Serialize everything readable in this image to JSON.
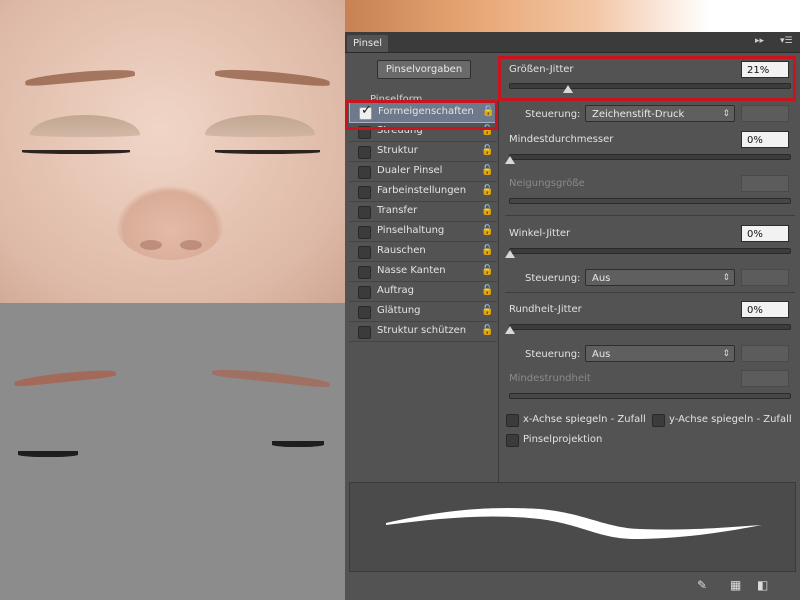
{
  "panel": {
    "tab_label": "Pinsel",
    "collapse_icon": "double-chevron-right-icon",
    "menu_icon": "panel-menu-icon",
    "preset_button": "Pinselvorgaben",
    "section_label": "Pinselform"
  },
  "options": [
    {
      "label": "Formeigenschaften",
      "checked": true,
      "selected": true
    },
    {
      "label": "Streuung",
      "checked": false
    },
    {
      "label": "Struktur",
      "checked": false
    },
    {
      "label": "Dualer Pinsel",
      "checked": false
    },
    {
      "label": "Farbeinstellungen",
      "checked": false
    },
    {
      "label": "Transfer",
      "checked": false
    },
    {
      "label": "Pinselhaltung",
      "checked": false
    },
    {
      "label": "Rauschen",
      "checked": false
    },
    {
      "label": "Nasse Kanten",
      "checked": false
    },
    {
      "label": "Auftrag",
      "checked": false
    },
    {
      "label": "Glättung",
      "checked": false
    },
    {
      "label": "Struktur schützen",
      "checked": false
    }
  ],
  "controls": {
    "size_jitter": {
      "label": "Größen-Jitter",
      "value": "21%",
      "slider": 0.21
    },
    "size_control": {
      "label": "Steuerung:",
      "value": "Zeichenstift-Druck"
    },
    "min_diameter": {
      "label": "Mindestdurchmesser",
      "value": "0%",
      "slider": 0
    },
    "tilt_scale": {
      "label": "Neigungsgröße"
    },
    "angle_jitter": {
      "label": "Winkel-Jitter",
      "value": "0%",
      "slider": 0
    },
    "angle_control": {
      "label": "Steuerung:",
      "value": "Aus"
    },
    "roundness_jitter": {
      "label": "Rundheit-Jitter",
      "value": "0%",
      "slider": 0
    },
    "roundness_control": {
      "label": "Steuerung:",
      "value": "Aus"
    },
    "min_roundness": {
      "label": "Mindestrundheit"
    },
    "flip_x": "x-Achse spiegeln - Zufall",
    "flip_y": "y-Achse spiegeln - Zufall",
    "projection": "Pinselprojektion"
  },
  "bottom_icons": [
    "brush-tool-icon",
    "grid-icon",
    "new-preset-icon"
  ],
  "colors": {
    "highlight": "#c8141e",
    "panel": "#535353",
    "selected_row": "#6e7a8c"
  }
}
